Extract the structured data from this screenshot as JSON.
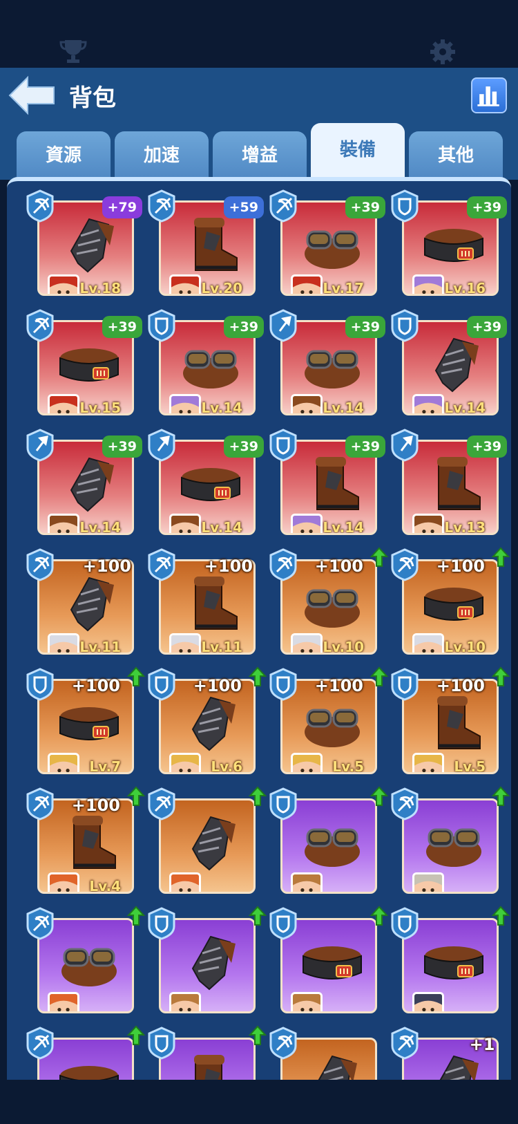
{
  "header": {
    "title": "背包"
  },
  "tabs": [
    {
      "label": "資源",
      "active": false
    },
    {
      "label": "加速",
      "active": false
    },
    {
      "label": "增益",
      "active": false
    },
    {
      "label": "裝備",
      "active": true
    },
    {
      "label": "其他",
      "active": false
    }
  ],
  "colors": {
    "accent": "#1d4f86",
    "bonus_green": "#3aa63a",
    "bonus_blue": "#3d6fd8",
    "bonus_purple": "#8a3cdc"
  },
  "items": [
    {
      "type": "crossbow-icon",
      "bonus": "+79",
      "bonus_style": "purple",
      "level": "Lv.18",
      "rarity": "red",
      "art": "gauntlet",
      "hero": "red-hair-hero",
      "upgrade": false
    },
    {
      "type": "crossbow-icon",
      "bonus": "+59",
      "bonus_style": "blue",
      "level": "Lv.20",
      "rarity": "red",
      "art": "boot",
      "hero": "red-hair-hero",
      "upgrade": false
    },
    {
      "type": "crossbow-icon",
      "bonus": "+39",
      "bonus_style": "green",
      "level": "Lv.17",
      "rarity": "red",
      "art": "goggles",
      "hero": "red-hair-hero",
      "upgrade": false
    },
    {
      "type": "shield-icon",
      "bonus": "+39",
      "bonus_style": "green",
      "level": "Lv.16",
      "rarity": "red",
      "art": "belt",
      "hero": "purple-hair-hero",
      "upgrade": false
    },
    {
      "type": "crossbow-icon",
      "bonus": "+39",
      "bonus_style": "green",
      "level": "Lv.15",
      "rarity": "red",
      "art": "belt",
      "hero": "red-hair-hero",
      "upgrade": false
    },
    {
      "type": "shield-icon",
      "bonus": "+39",
      "bonus_style": "green",
      "level": "Lv.14",
      "rarity": "red",
      "art": "goggles",
      "hero": "purple-hair-hero",
      "upgrade": false
    },
    {
      "type": "shovel-icon",
      "bonus": "+39",
      "bonus_style": "green",
      "level": "Lv.14",
      "rarity": "red",
      "art": "goggles",
      "hero": "brown-hair-hero",
      "upgrade": false
    },
    {
      "type": "shield-icon",
      "bonus": "+39",
      "bonus_style": "green",
      "level": "Lv.14",
      "rarity": "red",
      "art": "gauntlet",
      "hero": "purple-hair-hero",
      "upgrade": false
    },
    {
      "type": "shovel-icon",
      "bonus": "+39",
      "bonus_style": "green",
      "level": "Lv.14",
      "rarity": "red",
      "art": "gauntlet",
      "hero": "brown-hair-hero",
      "upgrade": false
    },
    {
      "type": "shovel-icon",
      "bonus": "+39",
      "bonus_style": "green",
      "level": "Lv.14",
      "rarity": "red",
      "art": "belt",
      "hero": "brown-hair-hero",
      "upgrade": false
    },
    {
      "type": "shield-icon",
      "bonus": "+39",
      "bonus_style": "green",
      "level": "Lv.14",
      "rarity": "red",
      "art": "boot",
      "hero": "purple-hair-hero",
      "upgrade": false
    },
    {
      "type": "shovel-icon",
      "bonus": "+39",
      "bonus_style": "green",
      "level": "Lv.13",
      "rarity": "red",
      "art": "boot",
      "hero": "brown-hair-hero",
      "upgrade": false
    },
    {
      "type": "crossbow-icon",
      "bonus": "+100",
      "bonus_style": "plain",
      "level": "Lv.11",
      "rarity": "orange",
      "art": "gauntlet",
      "hero": "white-hair-hero",
      "upgrade": false
    },
    {
      "type": "crossbow-icon",
      "bonus": "+100",
      "bonus_style": "plain",
      "level": "Lv.11",
      "rarity": "orange",
      "art": "boot",
      "hero": "white-hair-hero",
      "upgrade": false
    },
    {
      "type": "crossbow-icon",
      "bonus": "+100",
      "bonus_style": "plain",
      "level": "Lv.10",
      "rarity": "orange",
      "art": "goggles",
      "hero": "white-hair-hero",
      "upgrade": true
    },
    {
      "type": "crossbow-icon",
      "bonus": "+100",
      "bonus_style": "plain",
      "level": "Lv.10",
      "rarity": "orange",
      "art": "belt",
      "hero": "white-hair-hero",
      "upgrade": true
    },
    {
      "type": "shield-icon",
      "bonus": "+100",
      "bonus_style": "plain",
      "level": "Lv.7",
      "rarity": "orange",
      "art": "belt",
      "hero": "blonde-hero",
      "upgrade": true
    },
    {
      "type": "shield-icon",
      "bonus": "+100",
      "bonus_style": "plain",
      "level": "Lv.6",
      "rarity": "orange",
      "art": "gauntlet",
      "hero": "blonde-hero",
      "upgrade": true
    },
    {
      "type": "shield-icon",
      "bonus": "+100",
      "bonus_style": "plain",
      "level": "Lv.5",
      "rarity": "orange",
      "art": "goggles",
      "hero": "blonde-hero",
      "upgrade": true
    },
    {
      "type": "shield-icon",
      "bonus": "+100",
      "bonus_style": "plain",
      "level": "Lv.5",
      "rarity": "orange",
      "art": "boot",
      "hero": "blonde-hero",
      "upgrade": true
    },
    {
      "type": "crossbow-icon",
      "bonus": "+100",
      "bonus_style": "plain",
      "level": "Lv.4",
      "rarity": "orange",
      "art": "boot",
      "hero": "ginger-hero",
      "upgrade": true
    },
    {
      "type": "crossbow-icon",
      "bonus": "",
      "bonus_style": "plain",
      "level": "",
      "rarity": "orange",
      "art": "gauntlet",
      "hero": "ginger-hero",
      "upgrade": true
    },
    {
      "type": "shield-icon",
      "bonus": "",
      "bonus_style": "plain",
      "level": "",
      "rarity": "purple",
      "art": "goggles",
      "hero": "dwarf-hero",
      "upgrade": true
    },
    {
      "type": "crossbow-icon",
      "bonus": "",
      "bonus_style": "plain",
      "level": "",
      "rarity": "purple",
      "art": "goggles",
      "hero": "old-man-hero",
      "upgrade": true
    },
    {
      "type": "crossbow-icon",
      "bonus": "",
      "bonus_style": "plain",
      "level": "",
      "rarity": "purple",
      "art": "goggles",
      "hero": "ginger-hero",
      "upgrade": true
    },
    {
      "type": "shield-icon",
      "bonus": "",
      "bonus_style": "plain",
      "level": "",
      "rarity": "purple",
      "art": "gauntlet",
      "hero": "dwarf-hero",
      "upgrade": true
    },
    {
      "type": "shield-icon",
      "bonus": "",
      "bonus_style": "plain",
      "level": "",
      "rarity": "purple",
      "art": "belt",
      "hero": "dwarf-hero",
      "upgrade": true
    },
    {
      "type": "shield-icon",
      "bonus": "",
      "bonus_style": "plain",
      "level": "",
      "rarity": "purple",
      "art": "belt",
      "hero": "masked-hero",
      "upgrade": true
    },
    {
      "type": "crossbow-icon",
      "bonus": "",
      "bonus_style": "plain",
      "level": "",
      "rarity": "purple",
      "art": "belt",
      "hero": "",
      "upgrade": true
    },
    {
      "type": "shield-icon",
      "bonus": "",
      "bonus_style": "plain",
      "level": "",
      "rarity": "purple",
      "art": "boot",
      "hero": "",
      "upgrade": true
    },
    {
      "type": "crossbow-icon",
      "bonus": "",
      "bonus_style": "plain",
      "level": "",
      "rarity": "orange",
      "art": "gauntlet",
      "hero": "",
      "upgrade": false
    },
    {
      "type": "crossbow-icon",
      "bonus": "+1",
      "bonus_style": "plain",
      "level": "",
      "rarity": "purple",
      "art": "gauntlet",
      "hero": "",
      "upgrade": false
    }
  ]
}
